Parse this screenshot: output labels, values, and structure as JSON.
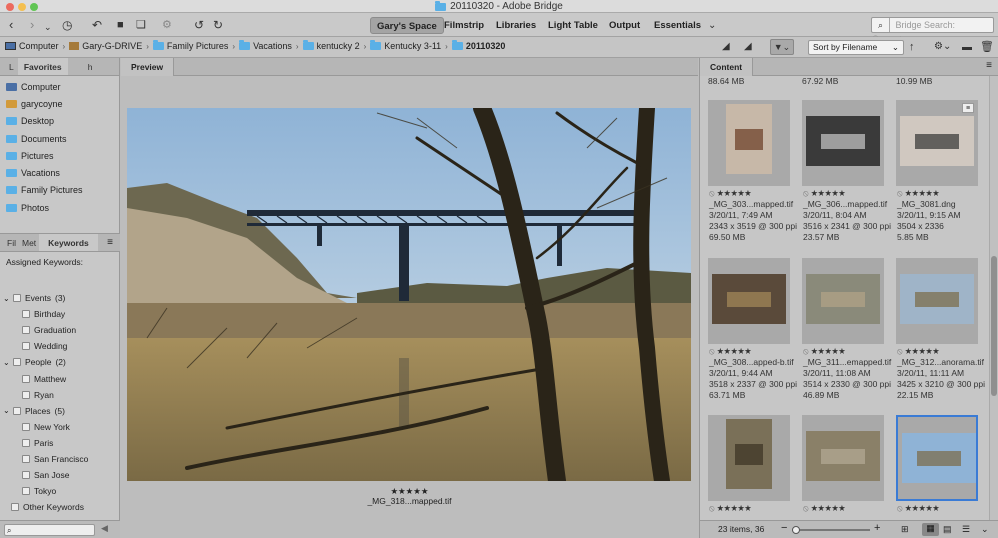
{
  "window": {
    "title": "20110320 - Adobe Bridge"
  },
  "toolbar": {
    "workspaces": [
      "Gary's Space",
      "Filmstrip",
      "Libraries",
      "Light Table",
      "Output",
      "Essentials"
    ],
    "search_placeholder": "Bridge Search: Current..."
  },
  "path": {
    "items": [
      "Computer",
      "Gary-G-DRIVE",
      "Family Pictures",
      "Vacations",
      "kentucky 2",
      "Kentucky 3-11",
      "20110320"
    ],
    "sort_label": "Sort by Filename"
  },
  "left": {
    "tabs": [
      "L",
      "Favorites",
      "h"
    ],
    "favorites": [
      "Computer",
      "garycoyne",
      "Desktop",
      "Documents",
      "Pictures",
      "Vacations",
      "Family Pictures",
      "Photos"
    ],
    "bottom_tabs": [
      "Fil",
      "Met",
      "Keywords"
    ],
    "assigned_label": "Assigned Keywords:",
    "keywords": [
      {
        "name": "Events",
        "count": "(3)",
        "children": [
          "Birthday",
          "Graduation",
          "Wedding"
        ]
      },
      {
        "name": "People",
        "count": "(2)",
        "children": [
          "Matthew",
          "Ryan"
        ]
      },
      {
        "name": "Places",
        "count": "(5)",
        "children": [
          "New York",
          "Paris",
          "San Francisco",
          "San Jose",
          "Tokyo"
        ]
      }
    ],
    "other_keywords": "Other Keywords"
  },
  "preview": {
    "tab": "Preview",
    "stars": "★★★★★",
    "filename": "_MG_318...mapped.tif"
  },
  "content": {
    "tab": "Content",
    "top_sizes": [
      "88.64 MB",
      "67.92 MB",
      "10.99 MB"
    ],
    "items": [
      {
        "name": "_MG_303...mapped.tif",
        "date": "3/20/11, 7:49 AM",
        "dims": "2343 x 3519 @ 300 ppi",
        "size": "69.50 MB",
        "stars": "★★★★★"
      },
      {
        "name": "_MG_306...mapped.tif",
        "date": "3/20/11, 8:04 AM",
        "dims": "3516 x 2341 @ 300 ppi",
        "size": "23.57 MB",
        "stars": "★★★★★"
      },
      {
        "name": "_MG_3081.dng",
        "date": "3/20/11, 9:15 AM",
        "dims": "3504 x 2336",
        "size": "5.85 MB",
        "stars": "★★★★★"
      },
      {
        "name": "_MG_308...apped-b.tif",
        "date": "3/20/11, 9:44 AM",
        "dims": "3518 x 2337 @ 300 ppi",
        "size": "63.71 MB",
        "stars": "★★★★★"
      },
      {
        "name": "_MG_311...emapped.tif",
        "date": "3/20/11, 11:08 AM",
        "dims": "3514 x 2330 @ 300 ppi",
        "size": "46.89 MB",
        "stars": "★★★★★"
      },
      {
        "name": "_MG_312...anorama.tif",
        "date": "3/20/11, 11:11 AM",
        "dims": "3425 x 3210 @ 300 ppi",
        "size": "22.15 MB",
        "stars": "★★★★★"
      },
      {
        "name": "",
        "date": "",
        "dims": "",
        "size": "",
        "stars": "★★★★★"
      },
      {
        "name": "",
        "date": "",
        "dims": "",
        "size": "",
        "stars": "★★★★★"
      },
      {
        "name": "",
        "date": "",
        "dims": "",
        "size": "",
        "stars": "★★★★★"
      }
    ],
    "status": "23 items, 36"
  },
  "colors": {
    "folder": "#5ab0e6",
    "selection": "#3a7bd5",
    "accent_dark": "#222222"
  }
}
